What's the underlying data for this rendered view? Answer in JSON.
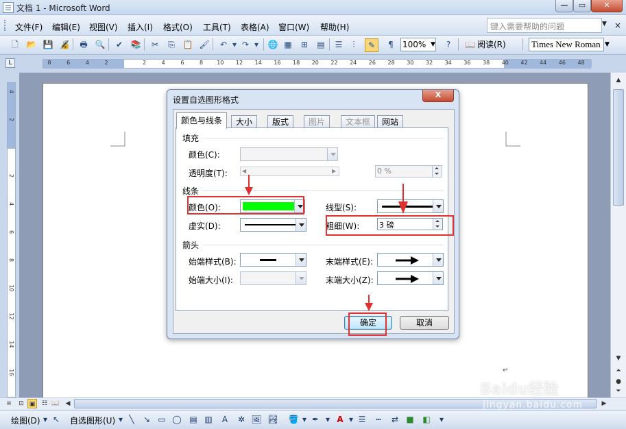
{
  "window": {
    "title": "文档 1 - Microsoft Word"
  },
  "menu": {
    "items": [
      "文件(F)",
      "编辑(E)",
      "视图(V)",
      "插入(I)",
      "格式(O)",
      "工具(T)",
      "表格(A)",
      "窗口(W)",
      "帮助(H)"
    ],
    "help_placeholder": "键入需要帮助的问题",
    "close_glyph": "×"
  },
  "toolbar": {
    "zoom": "100%",
    "read_label": "阅读(R)",
    "font_name": "Times New Roman"
  },
  "ruler": {
    "numbers": [
      "8",
      "6",
      "4",
      "2",
      "",
      "2",
      "4",
      "6",
      "8",
      "10",
      "12",
      "14",
      "16",
      "18",
      "20",
      "22",
      "24",
      "26",
      "28",
      "30",
      "32",
      "34",
      "36",
      "38",
      "40",
      "42",
      "44",
      "46",
      "48"
    ],
    "vnumbers": [
      "4",
      "2",
      "",
      "2",
      "4",
      "6",
      "8",
      "10",
      "12",
      "14",
      "16"
    ]
  },
  "drawbar": {
    "draw_label": "绘图(D)",
    "autoshape_label": "自选图形(U)"
  },
  "dialog": {
    "title": "设置自选图形格式",
    "close_glyph": "X",
    "tabs": [
      {
        "label": "颜色与线条",
        "active": true,
        "disabled": false
      },
      {
        "label": "大小",
        "active": false,
        "disabled": false
      },
      {
        "label": "版式",
        "active": false,
        "disabled": false
      },
      {
        "label": "图片",
        "active": false,
        "disabled": true
      },
      {
        "label": "文本框",
        "active": false,
        "disabled": true
      },
      {
        "label": "网站",
        "active": false,
        "disabled": false
      }
    ],
    "fill": {
      "section": "填充",
      "color_label": "颜色(C):",
      "transparency_label": "透明度(T):",
      "transparency_value": "0 %"
    },
    "line": {
      "section": "线条",
      "color_label": "颜色(O):",
      "color_value": "#00ff00",
      "style_label": "线型(S):",
      "dash_label": "虚实(D):",
      "weight_label": "粗细(W):",
      "weight_value": "3 磅"
    },
    "arrows": {
      "section": "箭头",
      "begin_style_label": "始端样式(B):",
      "end_style_label": "末端样式(E):",
      "begin_size_label": "始端大小(I):",
      "end_size_label": "末端大小(Z):"
    },
    "ok_label": "确定",
    "cancel_label": "取消"
  },
  "annotation_color": "#e03030",
  "watermark": {
    "brand": "Baidu经验",
    "url": "jingyan.baidu.com"
  }
}
